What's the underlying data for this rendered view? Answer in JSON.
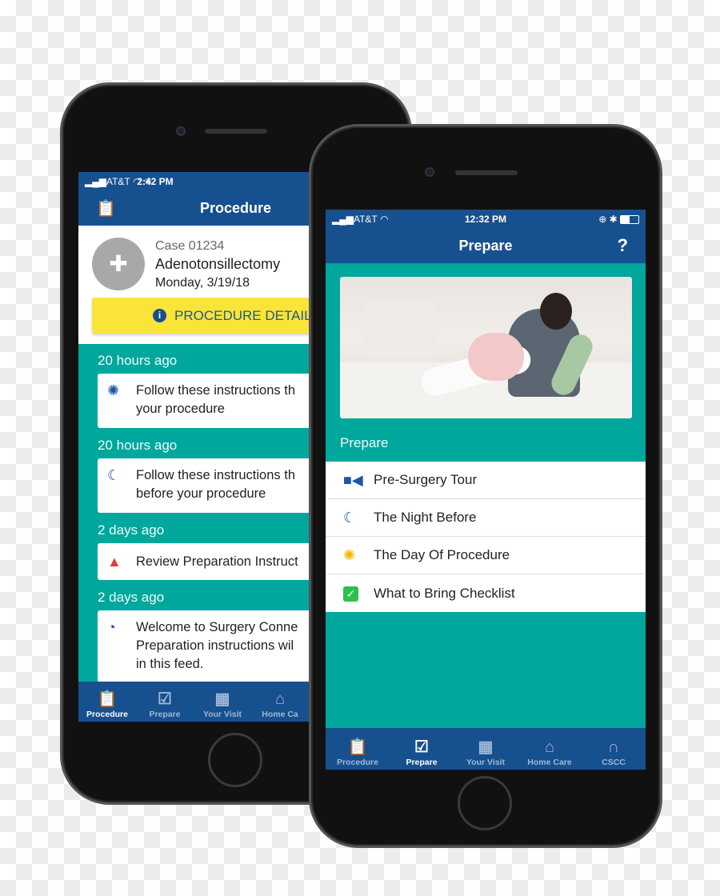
{
  "left_phone": {
    "status": {
      "carrier": "AT&T",
      "time": "2:42 PM"
    },
    "header": {
      "title": "Procedure"
    },
    "case": {
      "number": "Case 01234",
      "procedure": "Adenotonsillectomy",
      "date": "Monday, 3/19/18"
    },
    "details_button": "PROCEDURE DETAIL",
    "feed": [
      {
        "time": "20 hours ago",
        "icon": "sun-icon",
        "text": [
          "Follow these instructions th",
          "your procedure"
        ]
      },
      {
        "time": "20 hours ago",
        "icon": "moon-icon",
        "text": [
          "Follow these instructions th",
          "before your procedure"
        ]
      },
      {
        "time": "2 days ago",
        "icon": "warning-icon",
        "text": [
          "Review Preparation Instruct"
        ]
      },
      {
        "time": "2 days ago",
        "icon": "rss-icon",
        "text": [
          "Welcome to Surgery Conne",
          "Preparation instructions wil",
          "in this feed."
        ]
      }
    ],
    "tabs": [
      {
        "label": "Procedure",
        "active": true
      },
      {
        "label": "Prepare"
      },
      {
        "label": "Your Visit"
      },
      {
        "label": "Home Ca"
      }
    ]
  },
  "right_phone": {
    "status": {
      "carrier": "AT&T",
      "time": "12:32 PM"
    },
    "header": {
      "title": "Prepare",
      "help": "?"
    },
    "section_label": "Prepare",
    "items": [
      {
        "label": "Pre-Surgery Tour",
        "icon": "video-camera-icon",
        "color": "#1a56a8"
      },
      {
        "label": "The Night Before",
        "icon": "moon-icon",
        "color": "#1a56a8"
      },
      {
        "label": "The Day Of Procedure",
        "icon": "sun-icon",
        "color": "#f2b900"
      },
      {
        "label": "What to Bring Checklist",
        "icon": "checkbox-icon",
        "color": "#2fbf4f"
      }
    ],
    "tabs": [
      {
        "label": "Procedure"
      },
      {
        "label": "Prepare",
        "active": true
      },
      {
        "label": "Your Visit"
      },
      {
        "label": "Home Care"
      },
      {
        "label": "CSCC"
      }
    ]
  },
  "colors": {
    "primary": "#17508f",
    "teal": "#00a79c",
    "yellow": "#fbe43a"
  }
}
